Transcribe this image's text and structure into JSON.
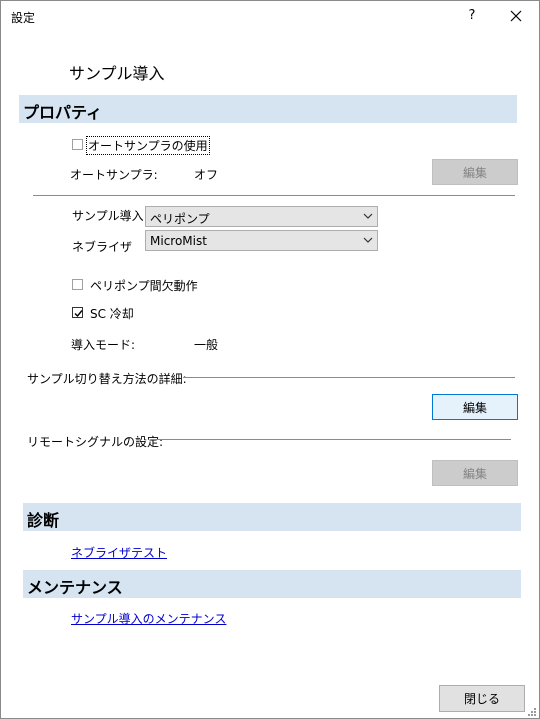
{
  "window": {
    "title": "設定",
    "help_label": "?"
  },
  "page_title": "サンプル導入",
  "sections": {
    "properties": "プロパティ",
    "diagnostics": "診断",
    "maintenance": "メンテナンス"
  },
  "properties": {
    "use_autosampler_label": "オートサンプラの使用",
    "use_autosampler_checked": false,
    "autosampler_label": "オートサンプラ:",
    "autosampler_value": "オフ",
    "edit_label": "編集",
    "sample_intro_label": "サンプル導入",
    "sample_intro_value": "ペリポンプ",
    "nebulizer_label": "ネブライザ",
    "nebulizer_value": "MicroMist",
    "peripump_intermittent_label": "ペリポンプ間欠動作",
    "peripump_intermittent_checked": false,
    "sc_cooling_label": "SC 冷却",
    "sc_cooling_checked": true,
    "intro_mode_label": "導入モード:",
    "intro_mode_value": "一般",
    "switch_detail_label": "サンプル切り替え方法の詳細:",
    "remote_signal_label": "リモートシグナルの設定:"
  },
  "diagnostics": {
    "nebulizer_test_link": "ネブライザテスト"
  },
  "maintenance": {
    "sample_intro_maint_link": "サンプル導入のメンテナンス"
  },
  "footer": {
    "close_label": "閉じる"
  },
  "colors": {
    "section_band": "#d6e4f2",
    "link": "#0000cc",
    "focus_border": "#0078d7"
  }
}
